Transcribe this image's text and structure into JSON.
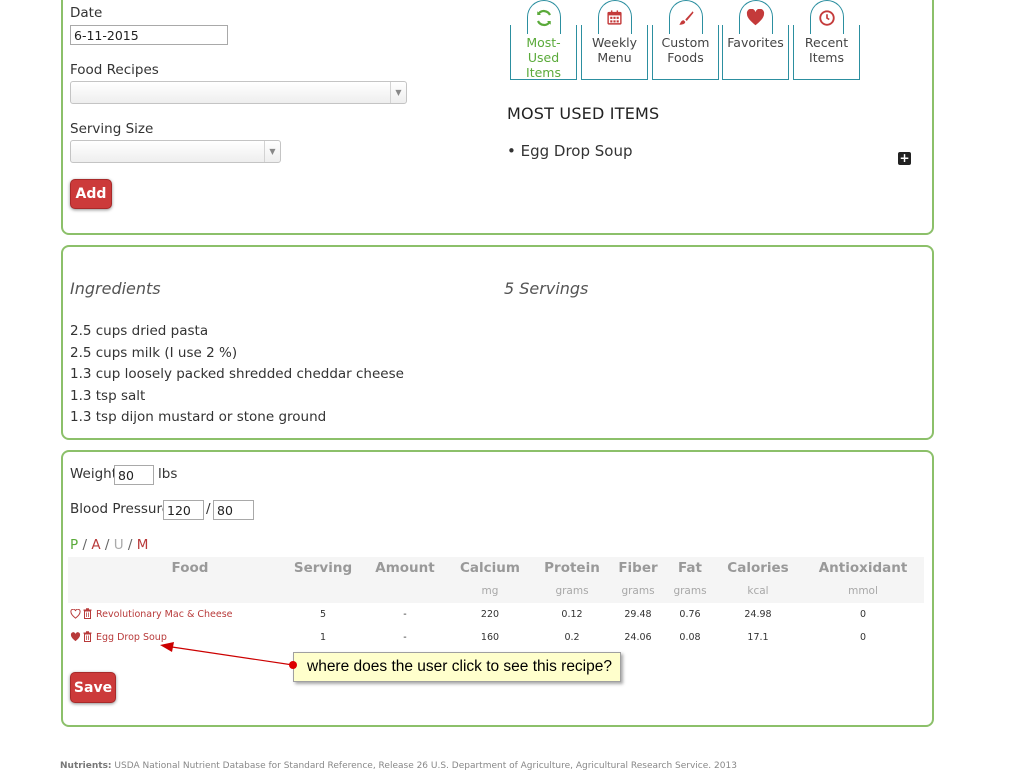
{
  "form": {
    "date_label": "Date",
    "date_value": "6-11-2015",
    "food_recipes_label": "Food Recipes",
    "food_recipes_selected": "",
    "serving_size_label": "Serving Size",
    "serving_size_selected": "",
    "add_label": "Add"
  },
  "tabs": [
    {
      "label": "Most-Used Items",
      "line1": "Most-Used",
      "line2": "Items",
      "icon": "refresh-icon",
      "active": true
    },
    {
      "label": "Weekly Menu",
      "line1": "Weekly",
      "line2": "Menu",
      "icon": "calendar-icon",
      "active": false
    },
    {
      "label": "Custom Foods",
      "line1": "Custom",
      "line2": "Foods",
      "icon": "brush-icon",
      "active": false
    },
    {
      "label": "Favorites",
      "line1": "Favorites",
      "line2": "",
      "icon": "heart-icon",
      "active": false
    },
    {
      "label": "Recent Items",
      "line1": "Recent",
      "line2": "Items",
      "icon": "clock-icon",
      "active": false
    }
  ],
  "most_used": {
    "title": "MOST USED ITEMS",
    "items": [
      "Egg Drop Soup"
    ],
    "expand_icon": "plus-icon"
  },
  "recipe": {
    "ingredients_heading": "Ingredients",
    "servings": "5 Servings",
    "ingredients": [
      "2.5 cups dried pasta",
      "2.5 cups milk (I use 2 %)",
      "1.3 cup loosely packed shredded cheddar cheese",
      "1.3 tsp salt",
      "1.3 tsp dijon mustard or stone ground"
    ]
  },
  "log": {
    "weight_label": "Weight",
    "weight_value": "80",
    "weight_unit": "lbs",
    "bp_label": "Blood Pressure",
    "bp_systolic": "120",
    "bp_separator": "/",
    "bp_diastolic": "80",
    "meal_filter": [
      "P",
      "A",
      "U",
      "M"
    ],
    "meal_sep": "/",
    "columns": [
      {
        "name": "Food",
        "unit": ""
      },
      {
        "name": "Serving",
        "unit": ""
      },
      {
        "name": "Amount",
        "unit": ""
      },
      {
        "name": "Calcium",
        "unit": "mg"
      },
      {
        "name": "Protein",
        "unit": "grams"
      },
      {
        "name": "Fiber",
        "unit": "grams"
      },
      {
        "name": "Fat",
        "unit": "grams"
      },
      {
        "name": "Calories",
        "unit": "kcal"
      },
      {
        "name": "Antioxidant",
        "unit": "mmol"
      }
    ],
    "rows": [
      {
        "food": "Revolutionary Mac & Cheese",
        "favorite": false,
        "serving": "5",
        "amount": "-",
        "calcium": "220",
        "protein": "0.12",
        "fiber": "29.48",
        "fat": "0.76",
        "calories": "24.98",
        "antioxidant": "0"
      },
      {
        "food": "Egg Drop Soup",
        "favorite": true,
        "serving": "1",
        "amount": "-",
        "calcium": "160",
        "protein": "0.2",
        "fiber": "24.06",
        "fat": "0.08",
        "calories": "17.1",
        "antioxidant": "0"
      }
    ],
    "save_label": "Save"
  },
  "annotation": {
    "text": "where does the user click to see this recipe?"
  },
  "footer": {
    "brand": "Nutrients:",
    "source": "USDA National Nutrient Database for Standard Reference, Release 26 U.S. Department of Agriculture, Agricultural Research Service. 2013"
  },
  "colors": {
    "panel_border": "#8cc06a",
    "accent_red": "#cc3a3a",
    "tab_border": "#2c8fa0",
    "active_green": "#5aaa3a",
    "link_red": "#b83a3a",
    "callout_bg": "#ffffcc"
  }
}
